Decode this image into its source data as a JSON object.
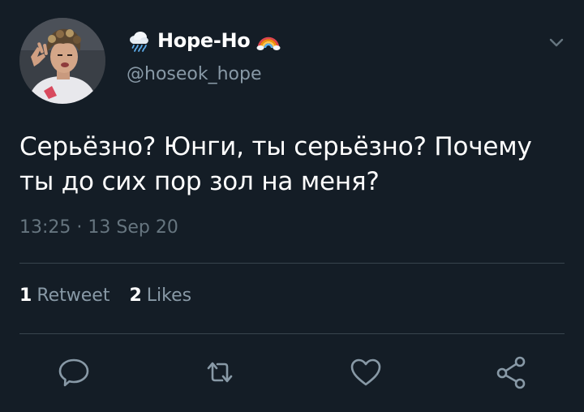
{
  "tweet": {
    "display_name": "Hope-Ho",
    "handle": "@hoseok_hope",
    "text_line_1": "Серьёзно? Юнги, ты серьёзно? Почему",
    "text_line_2": "ты до сих пор зол на меня?",
    "timestamp": "13:25 · 13 Sep 20"
  },
  "stats": {
    "retweets_count": "1",
    "retweets_label": "Retweet",
    "likes_count": "2",
    "likes_label": "Likes"
  },
  "icons": {
    "name_prefix": "rain-cloud-icon",
    "name_suffix": "rainbow-icon",
    "menu": "chevron-down-icon",
    "reply": "reply-icon",
    "retweet": "retweet-icon",
    "like": "heart-icon",
    "share": "share-icon"
  },
  "colors": {
    "background": "#141d26",
    "text": "#ffffff",
    "secondary": "#8899a6",
    "divider": "#38444d"
  }
}
